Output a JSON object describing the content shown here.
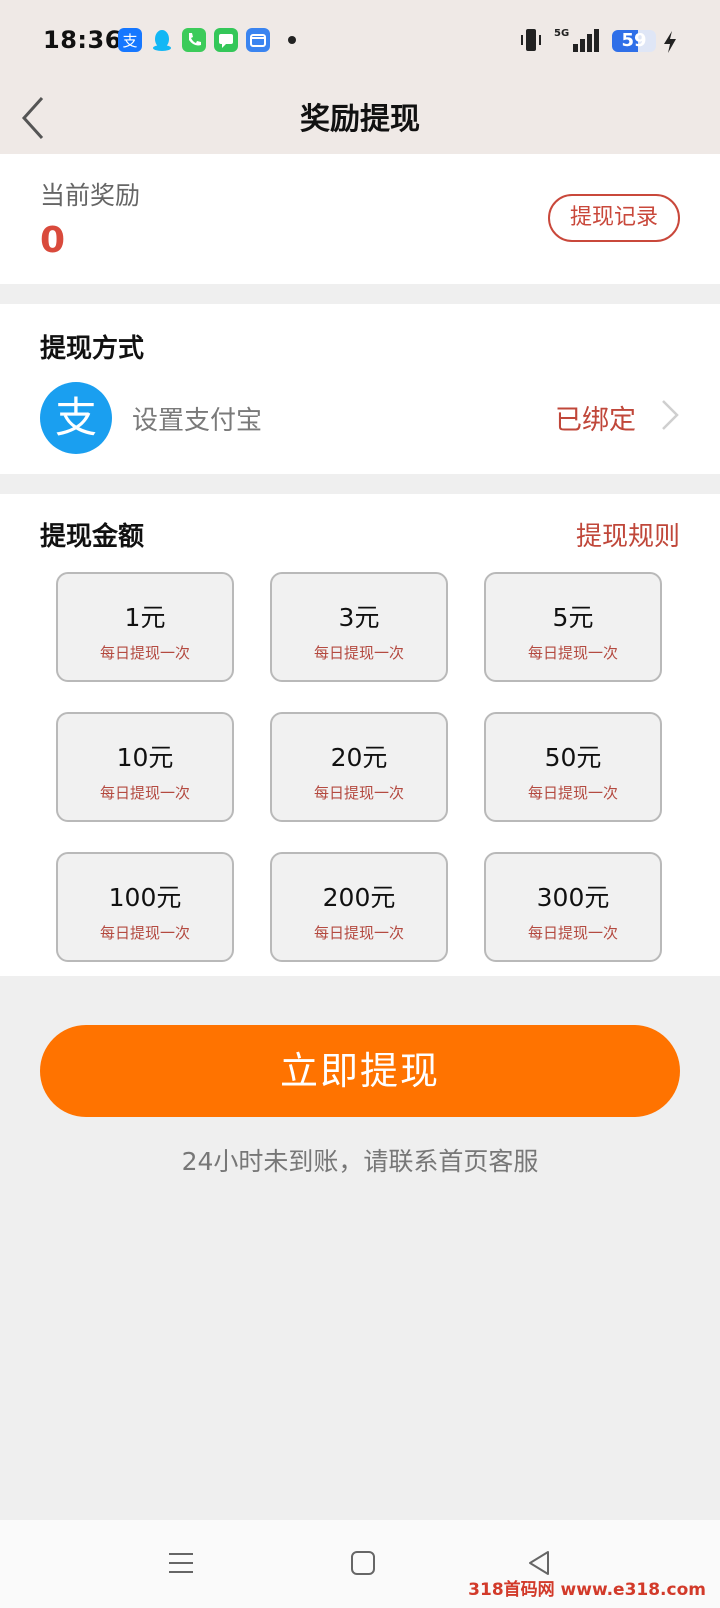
{
  "status_bar": {
    "time": "18:36",
    "battery": "59",
    "battery_level": 0.59,
    "signal": "5G",
    "app_icons": [
      "alipay-icon",
      "qq-icon",
      "phone-icon",
      "messages-icon",
      "window-icon"
    ]
  },
  "header": {
    "title": "奖励提现"
  },
  "reward": {
    "label": "当前奖励",
    "value": "0",
    "history_button": "提现记录"
  },
  "method": {
    "title": "提现方式",
    "alipay_label": "设置支付宝",
    "alipay_glyph": "支",
    "status": "已绑定"
  },
  "amount": {
    "title": "提现金额",
    "rules_link": "提现规则",
    "options": [
      {
        "value": "1元",
        "sub": "每日提现一次"
      },
      {
        "value": "3元",
        "sub": "每日提现一次"
      },
      {
        "value": "5元",
        "sub": "每日提现一次"
      },
      {
        "value": "10元",
        "sub": "每日提现一次"
      },
      {
        "value": "20元",
        "sub": "每日提现一次"
      },
      {
        "value": "50元",
        "sub": "每日提现一次"
      },
      {
        "value": "100元",
        "sub": "每日提现一次"
      },
      {
        "value": "200元",
        "sub": "每日提现一次"
      },
      {
        "value": "300元",
        "sub": "每日提现一次"
      }
    ]
  },
  "action": {
    "withdraw_button": "立即提现",
    "notice": "24小时未到账，请联系首页客服"
  },
  "watermark": "318首码网 www.e318.com",
  "colors": {
    "accent_orange": "#ff7300",
    "accent_red": "#c0473a",
    "alipay_blue": "#1a9ff0"
  }
}
